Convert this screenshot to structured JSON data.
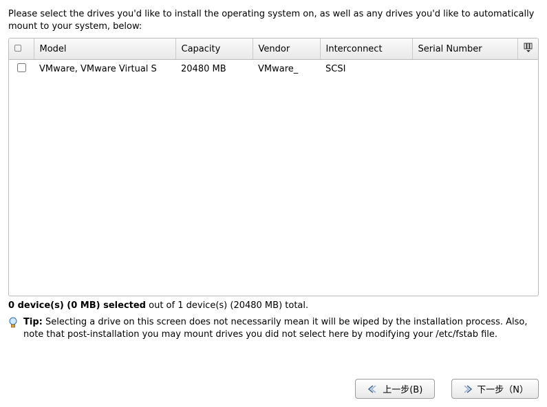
{
  "instruction": "Please select the drives you'd like to install the operating system on, as well as any drives you'd like to automatically mount to your system, below:",
  "columns": {
    "model": "Model",
    "capacity": "Capacity",
    "vendor": "Vendor",
    "interconnect": "Interconnect",
    "serial": "Serial Number"
  },
  "rows": [
    {
      "checked": false,
      "model": "VMware, VMware Virtual S",
      "capacity": "20480 MB",
      "vendor": "VMware_",
      "interconnect": "SCSI",
      "serial": ""
    }
  ],
  "selection": {
    "selected_bold": "0 device(s) (0 MB) selected",
    "total_rest": " out of 1 device(s) (20480 MB) total."
  },
  "tip": {
    "label": "Tip:",
    "text": " Selecting a drive on this screen does not necessarily mean it will be wiped by the installation process.  Also, note that post-installation you may mount drives you did not select here by modifying your /etc/fstab file."
  },
  "buttons": {
    "back": "上一步(B)",
    "next": "下一步（N）"
  }
}
